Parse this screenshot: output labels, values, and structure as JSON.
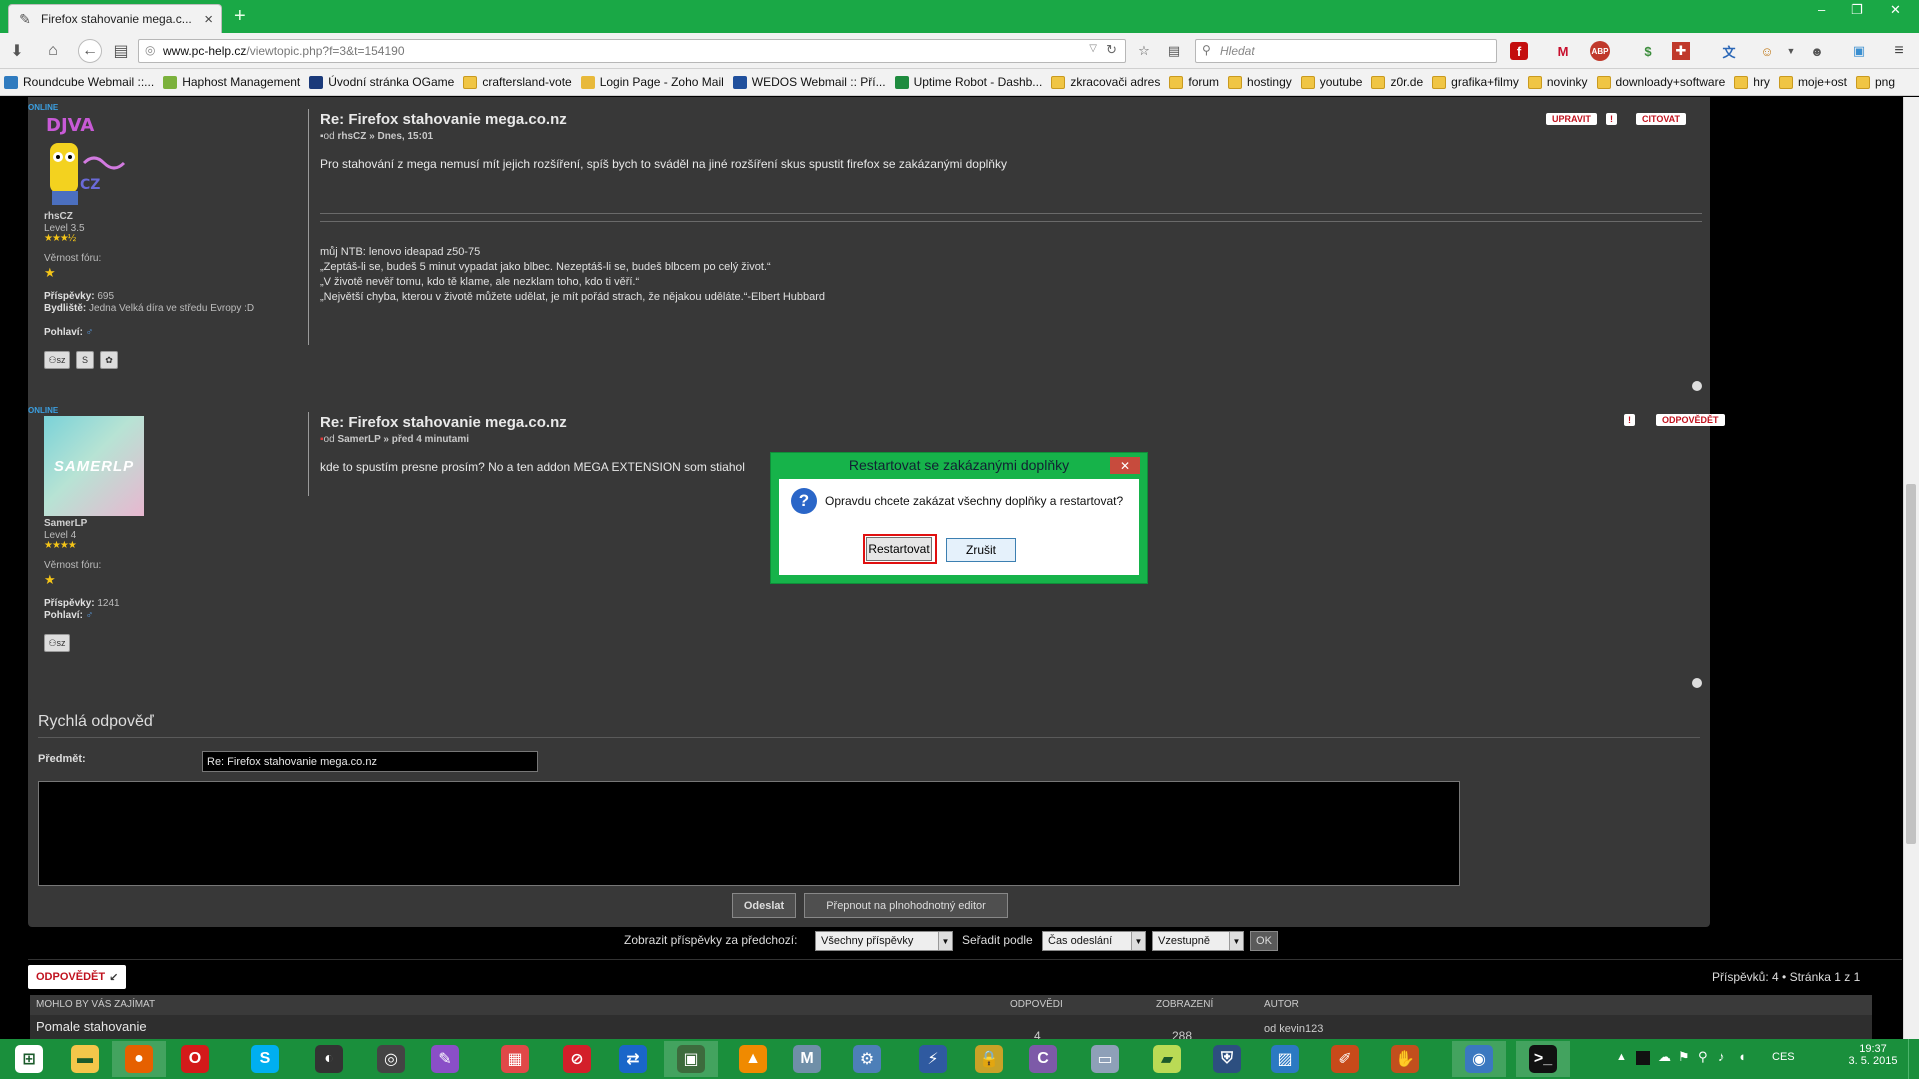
{
  "browser": {
    "tab_title": "Firefox stahovanie mega.c...",
    "tab_close": "×",
    "new_tab": "+",
    "url_domain": "www.pc-help.cz",
    "url_path": "/viewtopic.php?f=3&t=154190",
    "search_placeholder": "Hledat",
    "window_controls": [
      "–",
      "❐",
      "✕"
    ]
  },
  "bookmarks": [
    {
      "label": "Roundcube Webmail ::...",
      "icon": "roundcube-icon",
      "color": "#2f7bbf"
    },
    {
      "label": "Haphost Management",
      "icon": "haphost-icon",
      "color": "#7bb13c"
    },
    {
      "label": "Úvodní stránka OGame",
      "icon": "ogame-icon",
      "color": "#1b3a7a"
    },
    {
      "label": "craftersland-vote",
      "icon": "folder-icon",
      "color": "#f0c544"
    },
    {
      "label": "Login Page - Zoho Mail",
      "icon": "zoho-icon",
      "color": "#e8b93a"
    },
    {
      "label": "WEDOS Webmail :: Pří...",
      "icon": "wedos-icon",
      "color": "#1f4f9c"
    },
    {
      "label": "Uptime Robot - Dashb...",
      "icon": "uptime-icon",
      "color": "#1e8b3e"
    },
    {
      "label": "zkracovači adres",
      "icon": "folder-icon",
      "color": "#f0c544"
    },
    {
      "label": "forum",
      "icon": "folder-icon",
      "color": "#f0c544"
    },
    {
      "label": "hostingy",
      "icon": "folder-icon",
      "color": "#f0c544"
    },
    {
      "label": "youtube",
      "icon": "folder-icon",
      "color": "#f0c544"
    },
    {
      "label": "z0r.de",
      "icon": "folder-icon",
      "color": "#f0c544"
    },
    {
      "label": "grafika+filmy",
      "icon": "folder-icon",
      "color": "#f0c544"
    },
    {
      "label": "novinky",
      "icon": "folder-icon",
      "color": "#f0c544"
    },
    {
      "label": "downloady+software",
      "icon": "folder-icon",
      "color": "#f0c544"
    },
    {
      "label": "hry",
      "icon": "folder-icon",
      "color": "#f0c544"
    },
    {
      "label": "moje+ost",
      "icon": "folder-icon",
      "color": "#f0c544"
    },
    {
      "label": "png",
      "icon": "folder-icon",
      "color": "#f0c544"
    }
  ],
  "post1": {
    "online": "ONLINE",
    "username": "rhsCZ",
    "level": "Level 3.5",
    "stars": "★★★½",
    "loyalty_label": "Věrnost fóru:",
    "loyalty_star": "★",
    "posts_label": "Příspěvky:",
    "posts_value": "695",
    "location_label": "Bydliště:",
    "location_value": "Jedna Velká díra ve středu Evropy :D",
    "gender_label": "Pohlaví:",
    "gender_icon": "♂",
    "title": "Re: Firefox stahovanie mega.co.nz",
    "meta_prefix": "od ",
    "meta_user": "rhsCZ",
    "meta_time": " » Dnes, 15:01",
    "body": "Pro stahování z mega nemusí mít jejich rozšíření, spíš bych to sváděl na jiné rozšíření skus spustit firefox se zakázanými doplňky",
    "sig": [
      "můj NTB: lenovo ideapad z50-75",
      "„Zeptáš-li se, budeš 5 minut vypadat jako blbec. Nezeptáš-li se, budeš blbcem po celý život.“",
      "„V životě nevěř tomu, kdo tě klame, ale nezklam toho, kdo ti věří.“",
      "„Největší chyba, kterou v životě můžete udělat, je mít pořád strach, že nějakou uděláte.“-Elbert Hubbard"
    ],
    "btn_edit": "UPRAVIT",
    "btn_report": "!",
    "btn_quote": "CITOVAT",
    "pm_label": "sz"
  },
  "post2": {
    "online": "ONLINE",
    "avatar_text": "SAMERLP",
    "username": "SamerLP",
    "level": "Level 4",
    "stars": "★★★★",
    "loyalty_label": "Věrnost fóru:",
    "loyalty_star": "★",
    "posts_label": "Příspěvky:",
    "posts_value": "1241",
    "gender_label": "Pohlaví:",
    "gender_icon": "♂",
    "title": "Re: Firefox stahovanie mega.co.nz",
    "meta_prefix": "od ",
    "meta_user": "SamerLP",
    "meta_time": " » před 4 minutami",
    "body": "kde to spustím presne prosím? No a ten addon MEGA EXTENSION som stiahol",
    "btn_report": "!",
    "btn_reply": "ODPOVĚDĚT",
    "pm_label": "sz"
  },
  "dialog": {
    "title": "Restartovat se zakázanými doplňky",
    "close": "✕",
    "message": "Opravdu chcete zakázat všechny doplňky a restartovat?",
    "question_mark": "?",
    "btn_restart": "Restartovat",
    "btn_cancel": "Zrušit"
  },
  "quick_reply": {
    "heading": "Rychlá odpověď",
    "subject_label": "Předmět:",
    "subject_value": "Re: Firefox stahovanie mega.co.nz",
    "btn_send": "Odeslat",
    "btn_full_editor": "Přepnout na plnohodnotný editor"
  },
  "sort_bar": {
    "show_label": "Zobrazit příspěvky za předchozí:",
    "show_value": "Všechny příspěvky",
    "sort_label": "Seřadit podle",
    "sort_value": "Čas odeslání",
    "dir_value": "Vzestupně",
    "ok": "OK"
  },
  "footer": {
    "reply_btn": "ODPOVĚDĚT",
    "pagination": "Příspěvků: 4 • Stránka 1 z 1"
  },
  "related": {
    "headers": [
      "MOHLO BY VÁS ZAJÍMAT",
      "ODPOVĚDI",
      "ZOBRAZENÍ",
      "AUTOR"
    ],
    "row": {
      "title": "Pomale stahovanie",
      "replies": "4",
      "views": "288",
      "author": "od kevin123"
    }
  },
  "tray": {
    "lang": "CES",
    "time": "19:37",
    "date": "3. 5. 2015"
  },
  "taskbar_apps": [
    {
      "name": "windows-start-icon",
      "glyph": "⊞",
      "color": "#ffffff"
    },
    {
      "name": "file-explorer-icon",
      "glyph": "▬",
      "color": "#f3c64a"
    },
    {
      "name": "firefox-icon",
      "glyph": "●",
      "color": "#e66000"
    },
    {
      "name": "opera-icon",
      "glyph": "O",
      "color": "#d41a1a"
    },
    {
      "name": "skype-icon",
      "glyph": "S",
      "color": "#00aff0"
    },
    {
      "name": "app-dark-icon",
      "glyph": "◐",
      "color": "#333333"
    },
    {
      "name": "steelseries-icon",
      "glyph": "◎",
      "color": "#444444"
    },
    {
      "name": "feather-icon",
      "glyph": "✎",
      "color": "#8a4fc7"
    },
    {
      "name": "apps-grid-icon",
      "glyph": "▦",
      "color": "#e04848"
    },
    {
      "name": "no-entry-icon",
      "glyph": "⊘",
      "color": "#d31f2a"
    },
    {
      "name": "teamviewer-icon",
      "glyph": "⇄",
      "color": "#1a66c9"
    },
    {
      "name": "monitor-icon",
      "glyph": "▣",
      "color": "#3d6b3d"
    },
    {
      "name": "vlc-icon",
      "glyph": "▲",
      "color": "#f08a00"
    },
    {
      "name": "m-app-icon",
      "glyph": "M",
      "color": "#6f8fa8"
    },
    {
      "name": "security-icon",
      "glyph": "⚙",
      "color": "#4d7fb8"
    },
    {
      "name": "network-icon",
      "glyph": "⚡",
      "color": "#2f5aa0"
    },
    {
      "name": "lock-icon",
      "glyph": "🔒",
      "color": "#c9a227"
    },
    {
      "name": "ccleaner-icon",
      "glyph": "C",
      "color": "#7d5aa8"
    },
    {
      "name": "drive-icon",
      "glyph": "▭",
      "color": "#8ea0b8"
    },
    {
      "name": "folder-green-icon",
      "glyph": "▰",
      "color": "#bada55"
    },
    {
      "name": "usb-icon",
      "glyph": "⛨",
      "color": "#2d4f80"
    },
    {
      "name": "photos-icon",
      "glyph": "▨",
      "color": "#2b79c2"
    },
    {
      "name": "sketch-icon",
      "glyph": "✐",
      "color": "#c84a1a"
    },
    {
      "name": "hand-icon",
      "glyph": "✋",
      "color": "#c24f1d"
    },
    {
      "name": "dialog-app-icon",
      "glyph": "◉",
      "color": "#3b78c0"
    },
    {
      "name": "cmd-icon",
      "glyph": ">_",
      "color": "#111111"
    }
  ]
}
